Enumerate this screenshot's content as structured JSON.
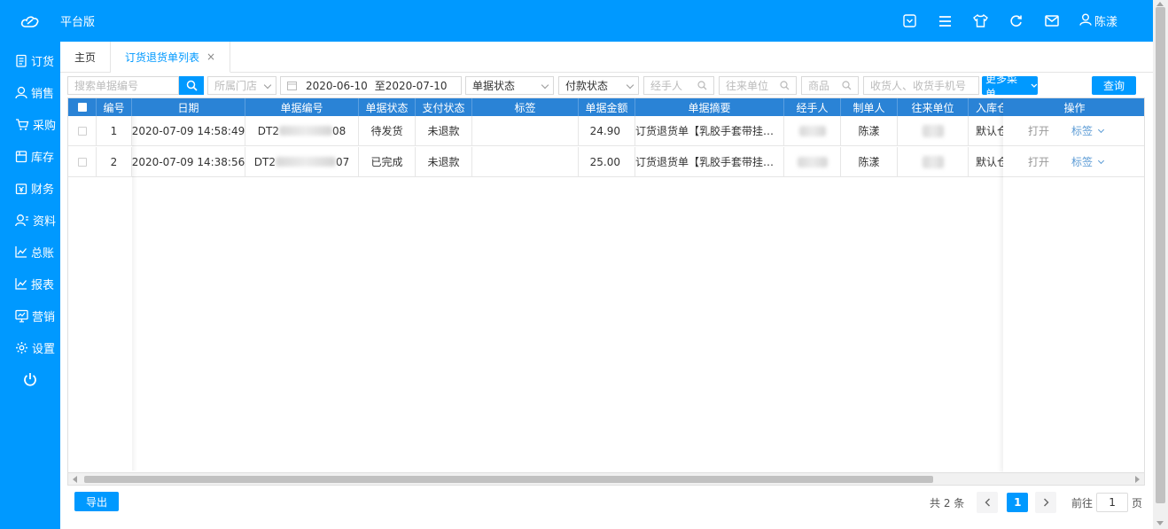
{
  "header": {
    "brand": "平台版",
    "user_name": "陈漾",
    "icons": [
      "dropdown-box-icon",
      "menu-icon",
      "shirt-icon",
      "refresh-icon",
      "mail-icon",
      "user-icon"
    ]
  },
  "sidebar": {
    "items": [
      {
        "label": "订货",
        "icon": "order-icon"
      },
      {
        "label": "销售",
        "icon": "sales-icon"
      },
      {
        "label": "采购",
        "icon": "cart-icon"
      },
      {
        "label": "库存",
        "icon": "inventory-icon"
      },
      {
        "label": "财务",
        "icon": "finance-icon"
      },
      {
        "label": "资料",
        "icon": "profile-icon"
      },
      {
        "label": "总账",
        "icon": "ledger-chart-icon"
      },
      {
        "label": "报表",
        "icon": "report-chart-icon"
      },
      {
        "label": "营销",
        "icon": "marketing-icon"
      },
      {
        "label": "设置",
        "icon": "gear-icon"
      }
    ],
    "power_icon": "power-icon"
  },
  "tabs": [
    {
      "label": "主页",
      "active": false
    },
    {
      "label": "订货退货单列表",
      "active": true,
      "closable": "×"
    }
  ],
  "filters": {
    "search_placeholder": "搜索单据编号",
    "store_placeholder": "所属门店",
    "date_start": "2020-06-10",
    "date_end": "至2020-07-10",
    "doc_status": "单据状态",
    "pay_status": "付款状态",
    "handler_placeholder": "经手人",
    "partner_placeholder": "往来单位",
    "product_placeholder": "商品",
    "receiver_placeholder": "收货人、收货手机号",
    "more_menu": "更多菜单",
    "query_button": "查询"
  },
  "table": {
    "columns": [
      "编号",
      "日期",
      "单据编号",
      "单据状态",
      "支付状态",
      "标签",
      "单据金额",
      "单据摘要",
      "经手人",
      "制单人",
      "往来单位",
      "入库仓",
      "操作"
    ],
    "rows": [
      {
        "no": "1",
        "date": "2020-07-09 14:58:49",
        "doc_prefix": "DT2",
        "doc_suffix": "08",
        "status": "待发货",
        "pay_status": "未退款",
        "tag": "",
        "amount": "24.90",
        "summary": "订货退货单【乳胶手套带挂…",
        "maker": "陈漾",
        "warehouse": "默认仓",
        "open": "打开",
        "tag_action": "标签"
      },
      {
        "no": "2",
        "date": "2020-07-09 14:38:56",
        "doc_prefix": "DT2",
        "doc_suffix": "07",
        "status": "已完成",
        "pay_status": "未退款",
        "tag": "",
        "amount": "25.00",
        "summary": "订货退货单【乳胶手套带挂…",
        "maker": "陈漾",
        "warehouse": "默认仓",
        "open": "打开",
        "tag_action": "标签"
      }
    ]
  },
  "footer": {
    "export_button": "导出",
    "total": "共 2 条",
    "current_page": "1",
    "goto_label": "前往",
    "goto_value": "1",
    "page_unit": "页"
  },
  "colors": {
    "primary": "#0099ff",
    "table_header": "#2a83d6",
    "link": "#5b9bd5"
  }
}
